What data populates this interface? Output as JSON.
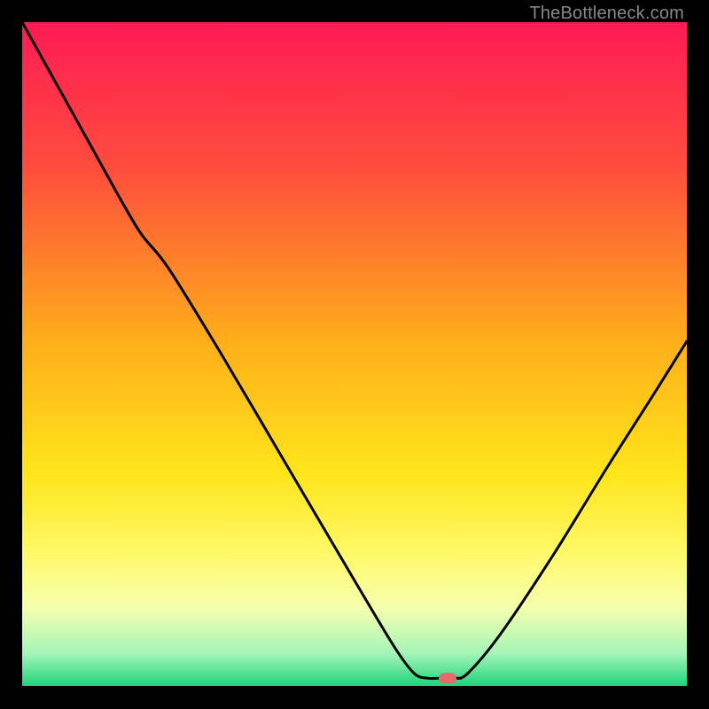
{
  "watermark": "TheBottleneck.com",
  "chart_data": {
    "type": "line",
    "title": "",
    "xlabel": "",
    "ylabel": "",
    "xlim": [
      0,
      100
    ],
    "ylim": [
      0,
      100
    ],
    "gradient_stops": [
      {
        "offset": 0,
        "color": "#ff1a55"
      },
      {
        "offset": 22,
        "color": "#ff4d3d"
      },
      {
        "offset": 48,
        "color": "#ffae1a"
      },
      {
        "offset": 68,
        "color": "#ffe51a"
      },
      {
        "offset": 80,
        "color": "#fff96a"
      },
      {
        "offset": 88,
        "color": "#f6ffad"
      },
      {
        "offset": 95,
        "color": "#a5f5b8"
      },
      {
        "offset": 100,
        "color": "#1ad27a"
      }
    ],
    "curve": [
      {
        "x": 0.0,
        "y": 100.0
      },
      {
        "x": 5.0,
        "y": 91.0
      },
      {
        "x": 10.0,
        "y": 82.0
      },
      {
        "x": 15.0,
        "y": 73.0
      },
      {
        "x": 18.0,
        "y": 68.0
      },
      {
        "x": 22.0,
        "y": 63.0
      },
      {
        "x": 30.0,
        "y": 50.0
      },
      {
        "x": 40.0,
        "y": 33.0
      },
      {
        "x": 50.0,
        "y": 16.0
      },
      {
        "x": 56.0,
        "y": 6.0
      },
      {
        "x": 59.0,
        "y": 2.0
      },
      {
        "x": 61.0,
        "y": 1.3
      },
      {
        "x": 63.0,
        "y": 1.3
      },
      {
        "x": 65.0,
        "y": 1.3
      },
      {
        "x": 67.0,
        "y": 2.0
      },
      {
        "x": 72.0,
        "y": 8.0
      },
      {
        "x": 80.0,
        "y": 20.0
      },
      {
        "x": 88.0,
        "y": 33.0
      },
      {
        "x": 95.0,
        "y": 44.0
      },
      {
        "x": 100.0,
        "y": 52.0
      }
    ],
    "marker": {
      "x": 64.0,
      "y": 1.3,
      "color": "#e56b6b",
      "rx": 10,
      "ry": 6
    }
  }
}
